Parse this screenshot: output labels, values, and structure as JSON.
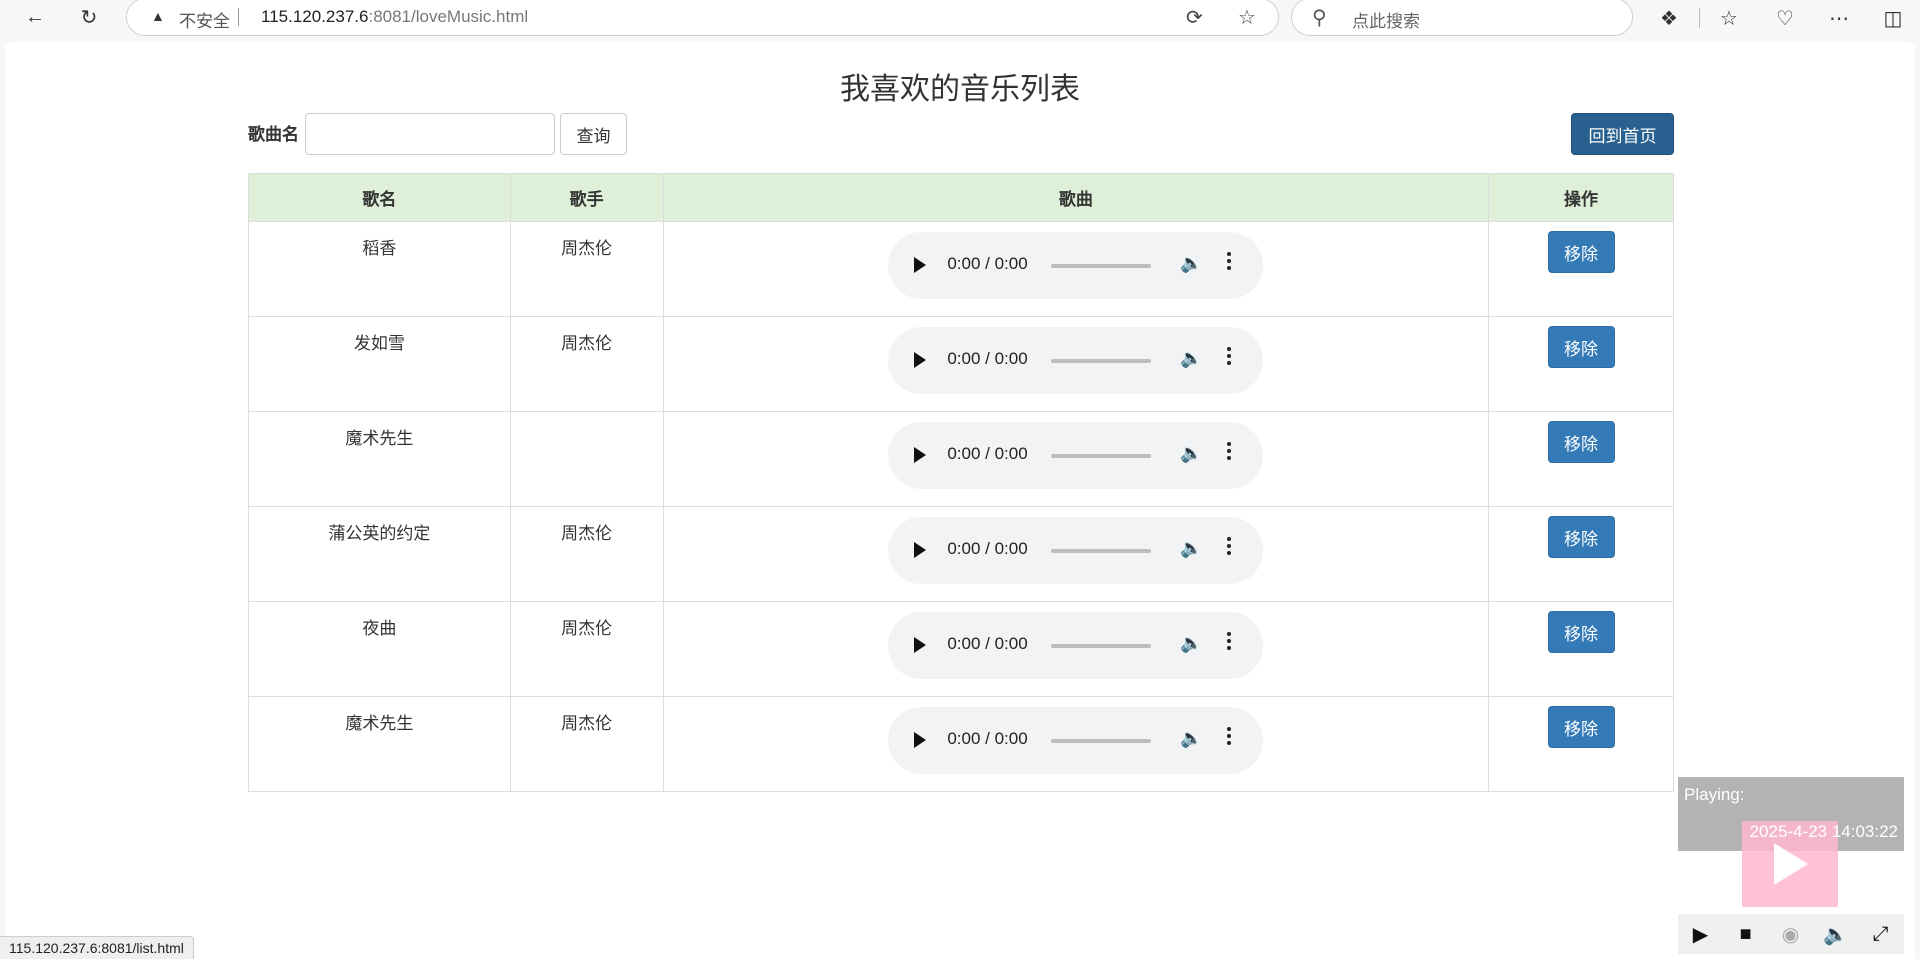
{
  "browser": {
    "insecure_label": "不安全",
    "url_host": "115.120.237.6",
    "url_rest": ":8081/loveMusic.html",
    "search_placeholder": "点此搜索"
  },
  "page": {
    "title": "我喜欢的音乐列表",
    "search_label": "歌曲名",
    "search_value": "",
    "query_button": "查询",
    "home_button": "回到首页"
  },
  "table": {
    "headers": [
      "歌名",
      "歌手",
      "歌曲",
      "操作"
    ],
    "rows": [
      {
        "title": "稻香",
        "artist": "周杰伦",
        "time": "0:00 / 0:00",
        "action": "移除"
      },
      {
        "title": "发如雪",
        "artist": "周杰伦",
        "time": "0:00 / 0:00",
        "action": "移除"
      },
      {
        "title": "魔术先生",
        "artist": "",
        "time": "0:00 / 0:00",
        "action": "移除"
      },
      {
        "title": "蒲公英的约定",
        "artist": "周杰伦",
        "time": "0:00 / 0:00",
        "action": "移除"
      },
      {
        "title": "夜曲",
        "artist": "周杰伦",
        "time": "0:00 / 0:00",
        "action": "移除"
      },
      {
        "title": "魔术先生",
        "artist": "周杰伦",
        "time": "0:00 / 0:00",
        "action": "移除"
      }
    ]
  },
  "widget": {
    "playing_label": "Playing:",
    "clock": "2025-4-23 14:03:22"
  },
  "status_bar": {
    "hover_url": "115.120.237.6:8081/list.html"
  },
  "colors": {
    "header_bg": "#dff0d8",
    "primary_button": "#337ab7",
    "home_button": "#286090"
  }
}
